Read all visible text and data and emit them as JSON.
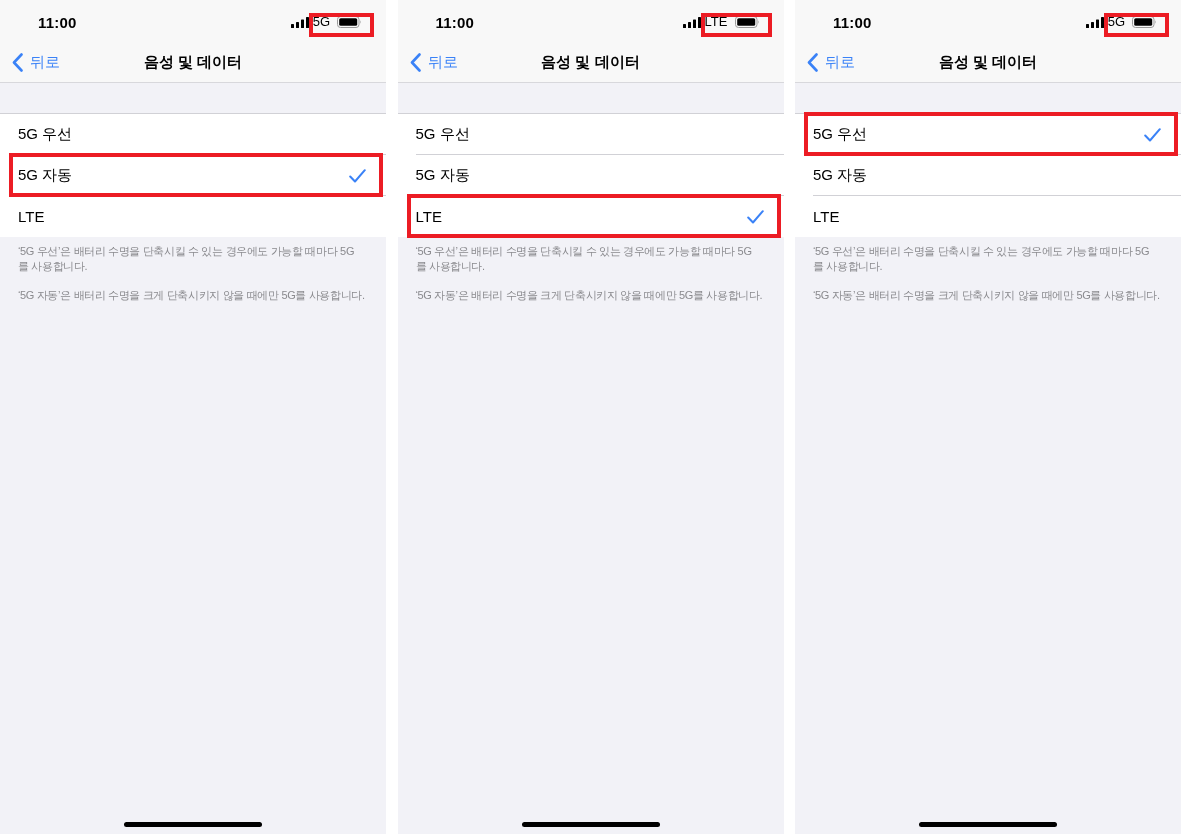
{
  "screens": [
    {
      "status_bar": {
        "time": "11:00",
        "network": "5G",
        "highlighted": true
      },
      "nav_bar": {
        "back": "뒤로",
        "title": "음성 및 데이터"
      },
      "options": [
        {
          "label": "5G 우선",
          "selected": false,
          "highlighted": false
        },
        {
          "label": "5G 자동",
          "selected": true,
          "highlighted": true
        },
        {
          "label": "LTE",
          "selected": false,
          "highlighted": false
        }
      ],
      "footer": [
        "‘5G 우선’은 배터리 수명을 단축시킬 수 있는 경우에도 가능할 때마다 5G를 사용합니다.",
        "‘5G 자동’은 배터리 수명을 크게 단축시키지 않을 때에만 5G를 사용합니다."
      ]
    },
    {
      "status_bar": {
        "time": "11:00",
        "network": "LTE",
        "highlighted": true
      },
      "nav_bar": {
        "back": "뒤로",
        "title": "음성 및 데이터"
      },
      "options": [
        {
          "label": "5G 우선",
          "selected": false,
          "highlighted": false
        },
        {
          "label": "5G 자동",
          "selected": false,
          "highlighted": false
        },
        {
          "label": "LTE",
          "selected": true,
          "highlighted": true
        }
      ],
      "footer": [
        "‘5G 우선’은 배터리 수명을 단축시킬 수 있는 경우에도 가능할 때마다 5G를 사용합니다.",
        "‘5G 자동’은 배터리 수명을 크게 단축시키지 않을 때에만 5G를 사용합니다."
      ]
    },
    {
      "status_bar": {
        "time": "11:00",
        "network": "5G",
        "highlighted": true
      },
      "nav_bar": {
        "back": "뒤로",
        "title": "음성 및 데이터"
      },
      "options": [
        {
          "label": "5G 우선",
          "selected": true,
          "highlighted": true
        },
        {
          "label": "5G 자동",
          "selected": false,
          "highlighted": false
        },
        {
          "label": "LTE",
          "selected": false,
          "highlighted": false
        }
      ],
      "footer": [
        "‘5G 우선’은 배터리 수명을 단축시킬 수 있는 경우에도 가능할 때마다 5G를 사용합니다.",
        "‘5G 자동’은 배터리 수명을 크게 단축시키지 않을 때에만 5G를 사용합니다."
      ]
    }
  ]
}
